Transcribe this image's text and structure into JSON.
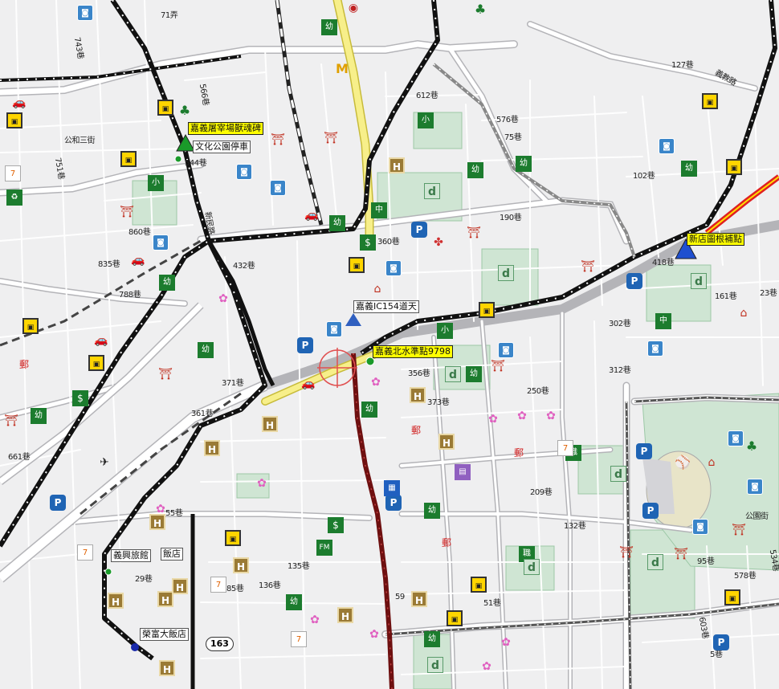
{
  "map": {
    "poi_yellow": [
      {
        "id": "chiayi-slaughterhouse",
        "text": "嘉義屠宰場獸魂碑"
      },
      {
        "id": "xindian-tower",
        "text": "新店圖根補點"
      },
      {
        "id": "chiayi-bei-shuizhun",
        "text": "嘉義北水準點9798"
      }
    ],
    "poi_white": [
      {
        "id": "park-parking",
        "text": "文化公園停車"
      },
      {
        "id": "ic-pass",
        "text": "嘉義IC154道天"
      },
      {
        "id": "yixing-hotel",
        "text": "義興旅館"
      },
      {
        "id": "hotel-2",
        "text": "飯店"
      },
      {
        "id": "rongying-hotel",
        "text": "榮富大飯店"
      }
    ],
    "highway_shields": [
      {
        "id": "hwy-163",
        "text": "163"
      }
    ],
    "lane_labels": [
      {
        "id": "l1",
        "text": "71弄"
      },
      {
        "id": "l2",
        "text": "743巷"
      },
      {
        "id": "l3",
        "text": "566巷"
      },
      {
        "id": "l4",
        "text": "544巷"
      },
      {
        "id": "l5",
        "text": "公和三街"
      },
      {
        "id": "l6",
        "text": "751巷"
      },
      {
        "id": "l7",
        "text": "新民路"
      },
      {
        "id": "l8",
        "text": "860巷"
      },
      {
        "id": "l9",
        "text": "432巷"
      },
      {
        "id": "l10",
        "text": "835巷"
      },
      {
        "id": "l11",
        "text": "788巷"
      },
      {
        "id": "l12",
        "text": "371巷"
      },
      {
        "id": "l13",
        "text": "361巷"
      },
      {
        "id": "l14",
        "text": "55巷"
      },
      {
        "id": "l15",
        "text": "29巷"
      },
      {
        "id": "l16",
        "text": "85巷"
      },
      {
        "id": "l17",
        "text": "136巷"
      },
      {
        "id": "l18",
        "text": "59"
      },
      {
        "id": "l19",
        "text": "312巷"
      },
      {
        "id": "l20",
        "text": "250巷"
      },
      {
        "id": "l21",
        "text": "209巷"
      },
      {
        "id": "l22",
        "text": "132巷"
      },
      {
        "id": "l23",
        "text": "302巷"
      },
      {
        "id": "l24",
        "text": "161巷"
      },
      {
        "id": "l25",
        "text": "95巷"
      },
      {
        "id": "l26",
        "text": "578巷"
      },
      {
        "id": "l27",
        "text": "534巷"
      },
      {
        "id": "l28",
        "text": "127巷"
      },
      {
        "id": "l29",
        "text": "102巷"
      },
      {
        "id": "l30",
        "text": "75巷"
      },
      {
        "id": "l31",
        "text": "576巷"
      },
      {
        "id": "l32",
        "text": "190巷"
      },
      {
        "id": "l33",
        "text": "360巷"
      },
      {
        "id": "l34",
        "text": "612巷"
      },
      {
        "id": "l35",
        "text": "373巷"
      },
      {
        "id": "l36",
        "text": "356巷"
      },
      {
        "id": "l37",
        "text": "義教路"
      },
      {
        "id": "l38",
        "text": "公園街"
      },
      {
        "id": "l39",
        "text": "51巷"
      },
      {
        "id": "l40",
        "text": "418巷"
      },
      {
        "id": "l41",
        "text": "23巷"
      },
      {
        "id": "l42",
        "text": "603巷"
      },
      {
        "id": "l43",
        "text": "5巷"
      },
      {
        "id": "l44",
        "text": "661巷"
      },
      {
        "id": "l45",
        "text": "135巷"
      }
    ],
    "colors": {
      "background": "#efeff0",
      "road": "#ffffff",
      "road_outline": "#b4b4b8",
      "main_road": "#f7ef8a",
      "railway": "#111111",
      "brown_rail": "#6e1010",
      "park": "#cfe5d3",
      "highlight_road": "#e02020"
    }
  }
}
